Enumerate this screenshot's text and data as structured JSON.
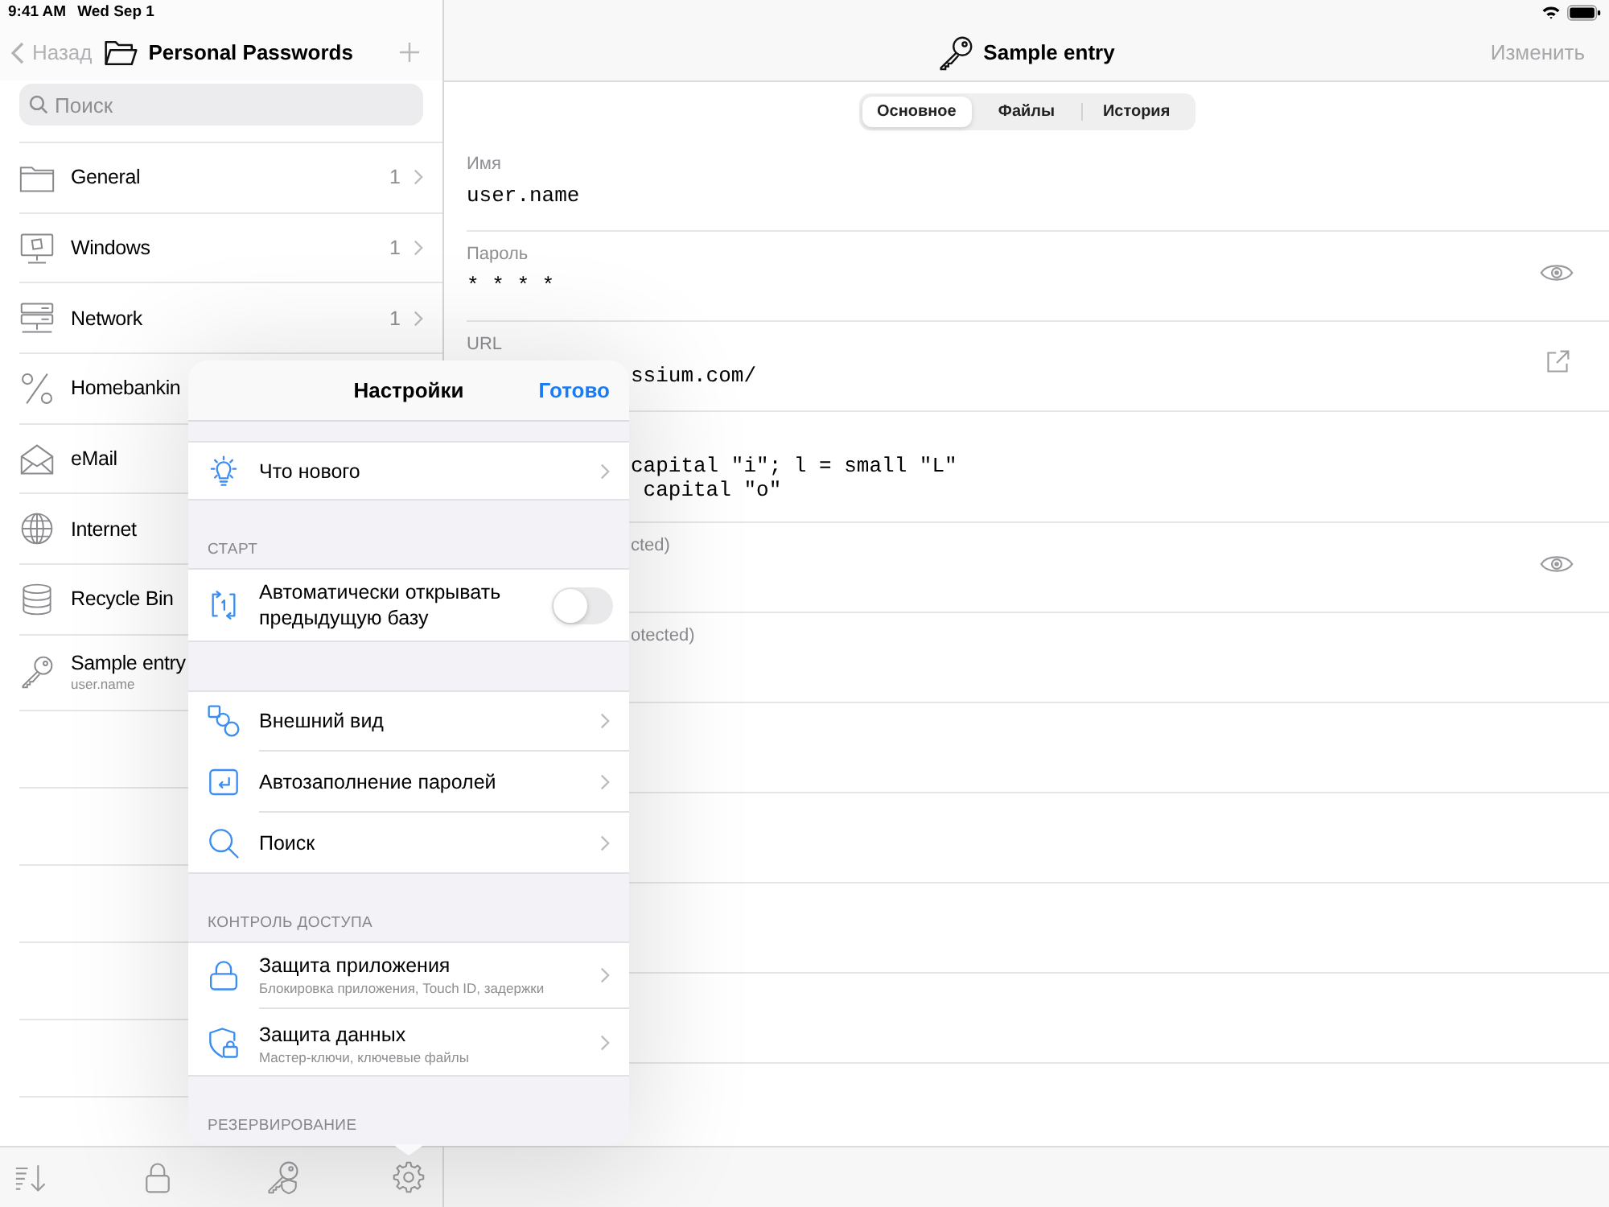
{
  "status_bar": {
    "time": "9:41 AM",
    "date": "Wed Sep 1"
  },
  "sidebar": {
    "back": "Назад",
    "title": "Personal Passwords",
    "search": {
      "placeholder": "Поиск"
    },
    "items": [
      {
        "kind": "group",
        "name": "General",
        "count": "1"
      },
      {
        "kind": "group",
        "name": "Windows",
        "count": "1"
      },
      {
        "kind": "group",
        "name": "Network",
        "count": "1"
      },
      {
        "kind": "group",
        "name": "Homebankin"
      },
      {
        "kind": "group",
        "name": "eMail"
      },
      {
        "kind": "group",
        "name": "Internet"
      },
      {
        "kind": "group",
        "name": "Recycle Bin"
      },
      {
        "kind": "entry",
        "name": "Sample entry",
        "subtitle": "user.name"
      }
    ]
  },
  "detail": {
    "title": "Sample entry",
    "edit": "Изменить",
    "tabs": [
      {
        "label": "Основное",
        "selected": true
      },
      {
        "label": "Файлы",
        "selected": false
      },
      {
        "label": "История",
        "selected": false
      }
    ],
    "fields": [
      {
        "kind": "text",
        "label": "Имя",
        "value": "user.name"
      },
      {
        "kind": "protected",
        "label": "Пароль",
        "value": "* * * *"
      },
      {
        "kind": "url",
        "label": "URL",
        "value": "ssium.com/",
        "value_cut": true
      },
      {
        "kind": "text",
        "value": "capital \"i\"; l = small \"L\"\n capital \"o\"",
        "value_cut": true
      },
      {
        "kind": "protected",
        "label": "cted)",
        "label_cut": true
      },
      {
        "kind": "text",
        "label": "otected)",
        "label_cut": true
      }
    ]
  },
  "settings": {
    "title": "Настройки",
    "done": "Готово",
    "sections": [
      {
        "rows": [
          {
            "kind": "link",
            "label": "Что нового"
          }
        ]
      },
      {
        "header": "СТАРТ",
        "rows": [
          {
            "kind": "toggle",
            "label": "Автоматически открывать предыдущую базу",
            "on": false
          }
        ]
      },
      {
        "rows": [
          {
            "kind": "link",
            "label": "Внешний вид"
          },
          {
            "kind": "link",
            "label": "Автозаполнение паролей"
          },
          {
            "kind": "link",
            "label": "Поиск"
          }
        ]
      },
      {
        "header": "КОНТРОЛЬ ДОСТУПА",
        "rows": [
          {
            "kind": "link",
            "label": "Защита приложения",
            "subtitle": "Блокировка приложения, Touch ID, задержки"
          },
          {
            "kind": "link",
            "label": "Защита данных",
            "subtitle": "Мастер-ключи, ключевые файлы"
          }
        ]
      },
      {
        "header": "РЕЗЕРВИРОВАНИЕ"
      }
    ]
  }
}
